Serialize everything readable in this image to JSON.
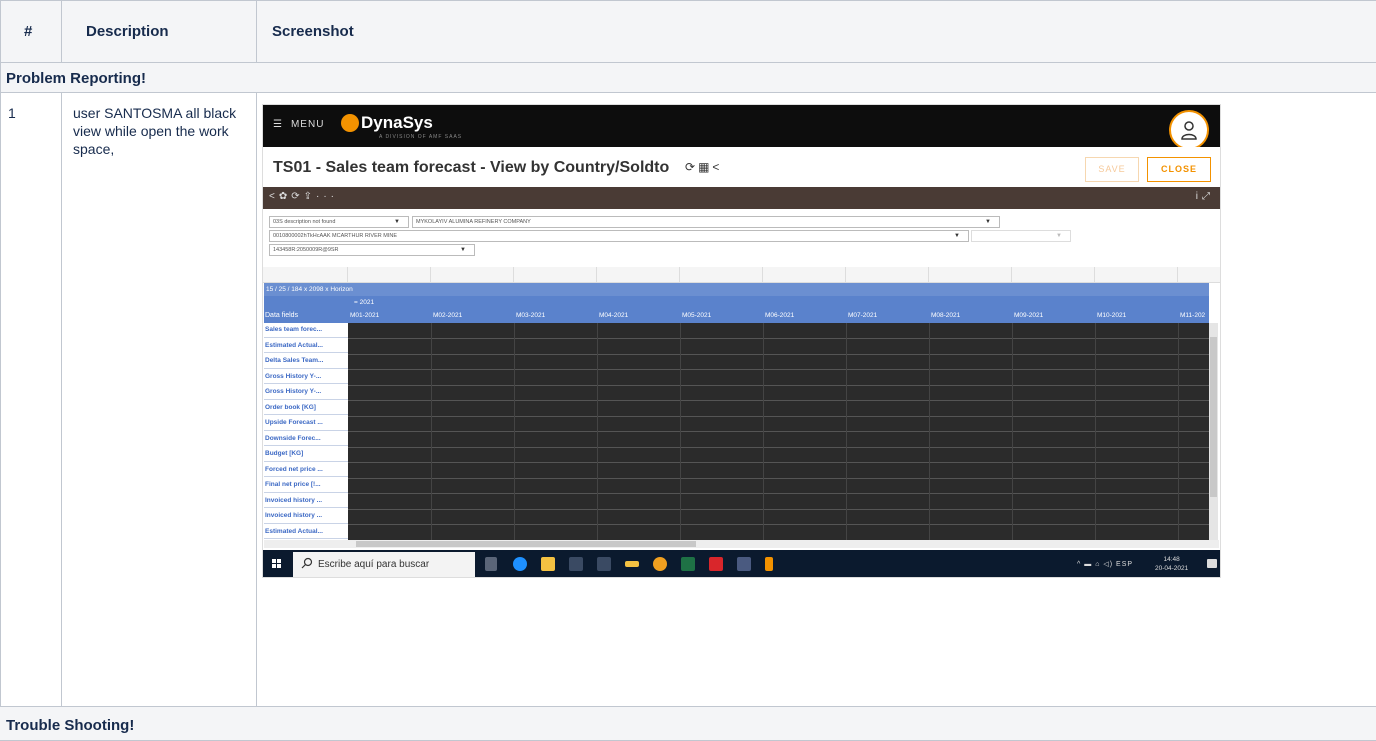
{
  "table": {
    "headers": [
      "#",
      "Description",
      "Screenshot"
    ],
    "sections": [
      "Problem Reporting!",
      "Trouble Shooting!"
    ],
    "row": {
      "number": "1",
      "description": "user SANTOSMA all black view while open the work space,"
    }
  },
  "app": {
    "menu_label": "MENU",
    "logo_text": "DynaSys",
    "logo_sub": "A DIVISION OF AMF SAAS",
    "title": "TS01 - Sales team forecast - View by Country/Soldto",
    "save_label": "SAVE",
    "close_label": "CLOSE",
    "filters": {
      "f1": "03S description not found",
      "f2": "MYKOLAYIV ALUMINA REFINERY COMPANY",
      "f3": "0010800002hTkHcAAK MCARTHUR RIVER MINE",
      "f4": "143458R:2050009R@9SR"
    },
    "grid": {
      "horizon": "15 / 25 / 184 x 2098 x Horizon",
      "year": "= 2021",
      "data_fields_label": "Data fields",
      "months": [
        "M01-2021",
        "M02-2021",
        "M03-2021",
        "M04-2021",
        "M05-2021",
        "M06-2021",
        "M07-2021",
        "M08-2021",
        "M09-2021",
        "M10-2021",
        "M11-202"
      ],
      "rows": [
        "Sales team forec...",
        "Estimated Actual...",
        "Delta Sales Team...",
        "Gross History Y-...",
        "Gross History Y-...",
        "Order book [KG]",
        "Upside Forecast ...",
        "Downside Forec...",
        "Budget [KG]",
        "Forced net price ...",
        "Final net price [!...",
        "Invoiced history ...",
        "Invoiced history ...",
        "Estimated Actual..."
      ]
    },
    "taskbar": {
      "search_placeholder": "Escribe aquí para buscar",
      "language": "ESP",
      "time": "14:48",
      "date": "20-04-2021"
    }
  },
  "colors": {
    "accent": "#f39200",
    "grid_header": "#5a82cc",
    "grid_label": "#3b68c4",
    "dark_cells": "#2b2b2b"
  }
}
